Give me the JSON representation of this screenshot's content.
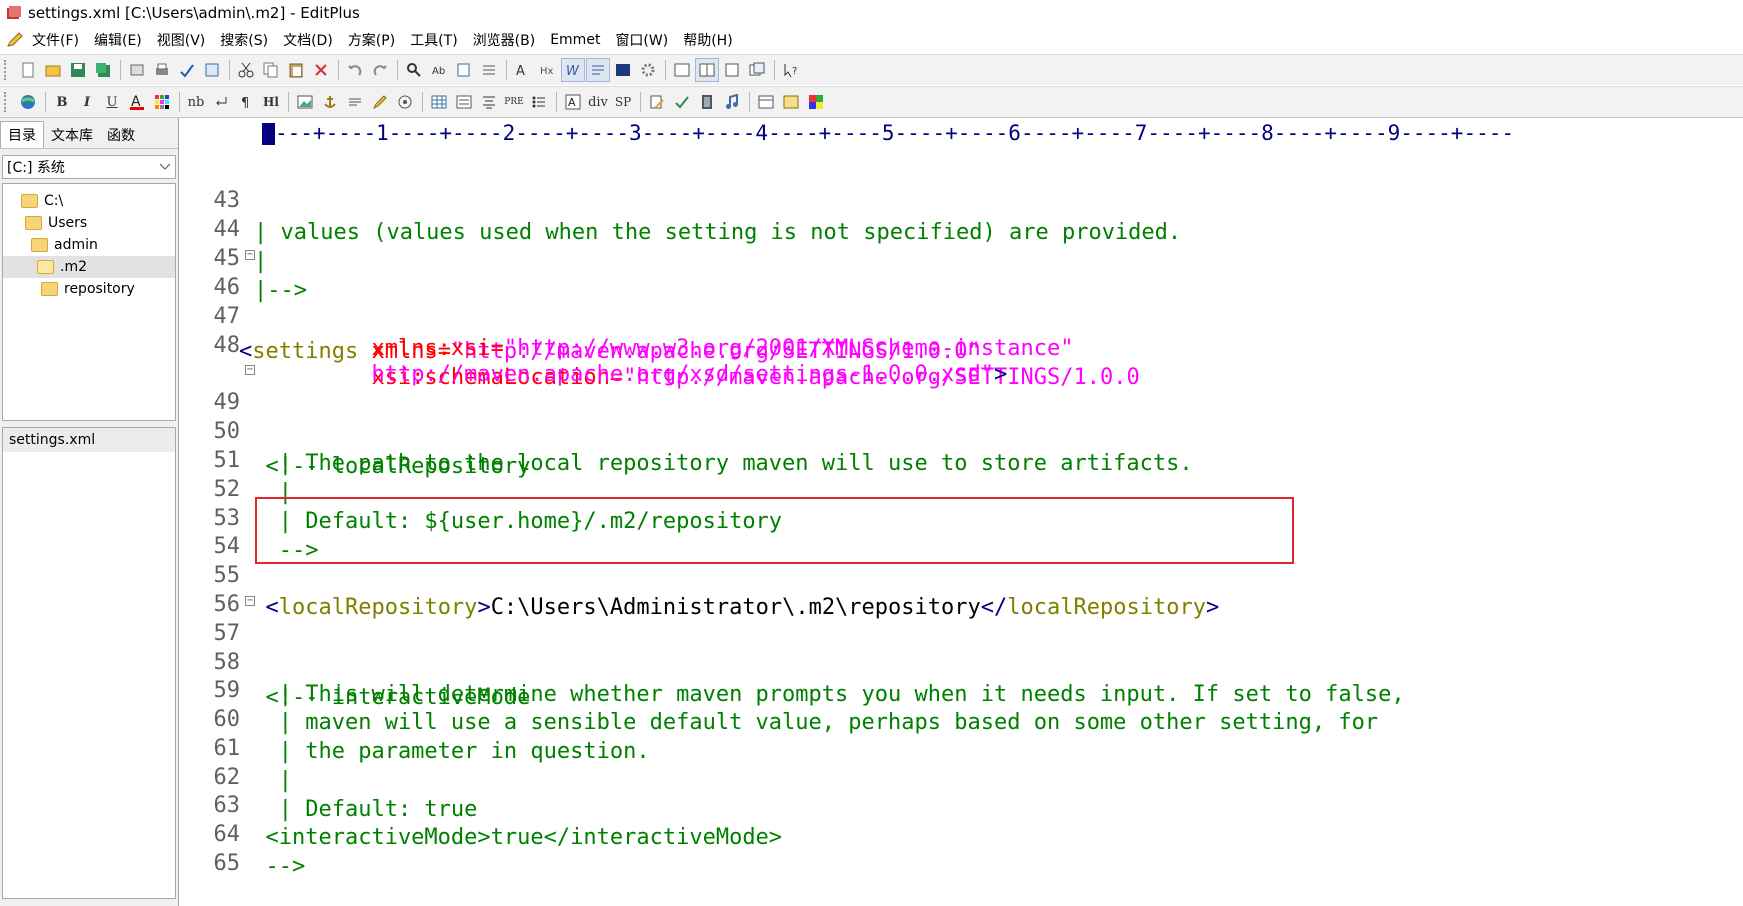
{
  "window": {
    "title": "settings.xml [C:\\Users\\admin\\.m2] - EditPlus"
  },
  "menu": [
    "文件(F)",
    "编辑(E)",
    "视图(V)",
    "搜索(S)",
    "文档(D)",
    "方案(P)",
    "工具(T)",
    "浏览器(B)",
    "Emmet",
    "窗口(W)",
    "帮助(H)"
  ],
  "toolbar2_text": {
    "bold": "B",
    "italic": "I",
    "underline": "U",
    "nb": "nb",
    "hl": "Hl",
    "pre": "PRE",
    "div": "div",
    "sp": "SP"
  },
  "sidebar": {
    "tabs": [
      "目录",
      "文本库",
      "函数"
    ],
    "drive": "[C:] 系统",
    "tree": [
      "C:\\",
      "Users",
      "admin",
      ".m2",
      "repository"
    ],
    "files": [
      "settings.xml"
    ]
  },
  "ruler": "---+----1----+----2----+----3----+----4----+----5----+----6----+----7----+----8----+----9----+----",
  "lines": {
    "l43": {
      "n": "43",
      "t": "| values (values used when the setting is not specified) are provided."
    },
    "l44": {
      "n": "44",
      "t": "|"
    },
    "l45": {
      "n": "45",
      "t": "|-->"
    },
    "l46": {
      "n": "46",
      "open": "<",
      "name": "settings",
      "attr": " xmlns=",
      "val": "\"http://maven.apache.org/SETTINGS/1.0.0\""
    },
    "l47": {
      "n": "47",
      "indent": "          ",
      "attr": "xmlns:xsi=",
      "val": "\"http://www.w3.org/2001/XMLSchema-instance\""
    },
    "l48": {
      "n": "48",
      "indent": "          ",
      "attr": "xsi:schemaLocation=",
      "val": "\"http://maven.apache.org/SETTINGS/1.0.0"
    },
    "l48b": {
      "indent": "          ",
      "val": "http://maven.apache.org/xsd/settings-1.0.0.xsd\"",
      "close": ">"
    },
    "l49": {
      "n": "49",
      "t": "  <!-- localRepository"
    },
    "l50": {
      "n": "50",
      "t": "   | The path to the local repository maven will use to store artifacts."
    },
    "l51": {
      "n": "51",
      "t": "   |"
    },
    "l52": {
      "n": "52",
      "t": "   | Default: ${user.home}/.m2/repository"
    },
    "l53": {
      "n": "53",
      "t": "   -->"
    },
    "l54": {
      "n": "54"
    },
    "l55": {
      "n": "55",
      "indent": "  ",
      "open": "<",
      "name": "localRepository",
      "close": ">",
      "text": "C:\\Users\\Administrator\\.m2\\repository",
      "endopen": "</",
      "endname": "localRepository",
      "endclose": ">"
    },
    "l56": {
      "n": "56"
    },
    "l57": {
      "n": "57",
      "t": "  <!-- interactiveMode"
    },
    "l58": {
      "n": "58",
      "t": "   | This will determine whether maven prompts you when it needs input. If set to false,"
    },
    "l59": {
      "n": "59",
      "t": "   | maven will use a sensible default value, perhaps based on some other setting, for"
    },
    "l60": {
      "n": "60",
      "t": "   | the parameter in question."
    },
    "l61": {
      "n": "61",
      "t": "   |"
    },
    "l62": {
      "n": "62",
      "t": "   | Default: true"
    },
    "l63": {
      "n": "63",
      "t": "  <interactiveMode>true</interactiveMode>"
    },
    "l64": {
      "n": "64",
      "t": "  -->"
    },
    "l65": {
      "n": "65"
    }
  },
  "colors": {
    "comment": "#008000",
    "tag": "#000080",
    "tag_name": "#808000",
    "attribute": "#ff0000",
    "value": "#ff00ff",
    "highlight_border": "#e0262b"
  }
}
